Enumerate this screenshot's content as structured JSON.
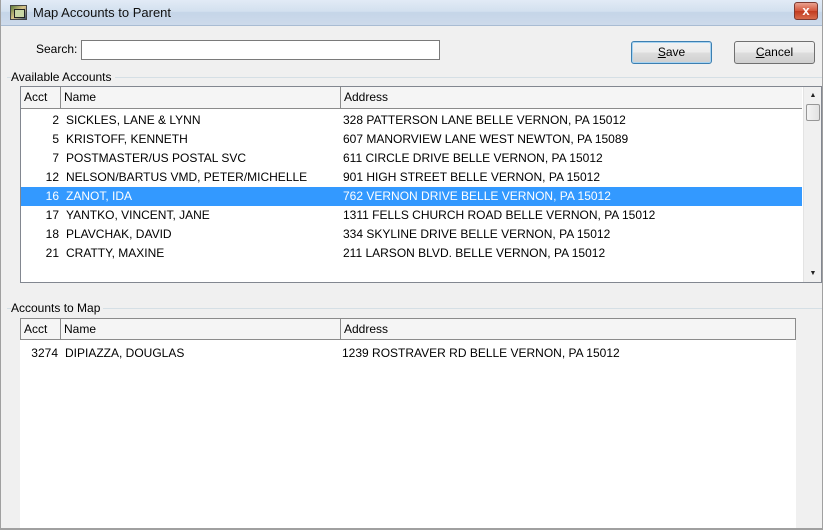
{
  "window": {
    "title": "Map Accounts to Parent",
    "close_glyph": "x"
  },
  "search": {
    "label": "Search:",
    "value": ""
  },
  "buttons": {
    "save_mnemonic": "S",
    "save_rest": "ave",
    "cancel_mnemonic": "C",
    "cancel_rest": "ancel"
  },
  "available": {
    "group_label": "Available Accounts",
    "columns": {
      "acct": "Acct",
      "name": "Name",
      "address": "Address"
    },
    "rows": [
      {
        "acct": "2",
        "name": "SICKLES, LANE & LYNN",
        "address": "328 PATTERSON LANE BELLE VERNON, PA 15012",
        "selected": false
      },
      {
        "acct": "5",
        "name": "KRISTOFF, KENNETH",
        "address": "607 MANORVIEW LANE WEST NEWTON, PA 15089",
        "selected": false
      },
      {
        "acct": "7",
        "name": "POSTMASTER/US POSTAL SVC",
        "address": "611 CIRCLE DRIVE BELLE VERNON, PA 15012",
        "selected": false
      },
      {
        "acct": "12",
        "name": "NELSON/BARTUS  VMD, PETER/MICHELLE",
        "address": "901 HIGH STREET BELLE VERNON, PA 15012",
        "selected": false
      },
      {
        "acct": "16",
        "name": "ZANOT, IDA",
        "address": "762 VERNON DRIVE BELLE VERNON, PA 15012",
        "selected": true
      },
      {
        "acct": "17",
        "name": "YANTKO, VINCENT, JANE",
        "address": "1311 FELLS CHURCH ROAD BELLE VERNON, PA 15012",
        "selected": false
      },
      {
        "acct": "18",
        "name": "PLAVCHAK, DAVID",
        "address": "334 SKYLINE DRIVE BELLE VERNON, PA 15012",
        "selected": false
      },
      {
        "acct": "21",
        "name": "CRATTY, MAXINE",
        "address": "211 LARSON BLVD. BELLE VERNON, PA 15012",
        "selected": false
      }
    ],
    "scroll": {
      "up_glyph": "▲",
      "down_glyph": "▼"
    }
  },
  "to_map": {
    "group_label": "Accounts to Map",
    "columns": {
      "acct": "Acct",
      "name": "Name",
      "address": "Address"
    },
    "rows": [
      {
        "acct": "3274",
        "name": "DIPIAZZA, DOUGLAS",
        "address": "1239 ROSTRAVER RD BELLE VERNON, PA 15012",
        "selected": false
      }
    ]
  },
  "colors": {
    "selection": "#3399ff",
    "selection_text": "#ffffff"
  }
}
